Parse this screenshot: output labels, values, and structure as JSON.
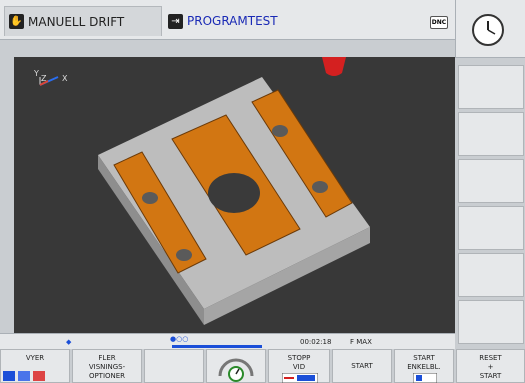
{
  "header": {
    "mode_manual_label": "MANUELL DRIFT",
    "mode_program_label": "PROGRAMTEST",
    "dnc_label": "DNC"
  },
  "viewport": {
    "axis_y": "Y",
    "axis_z": "Z",
    "axis_x": "X"
  },
  "status_bar": {
    "time": "00:02:18",
    "feed": "F MAX"
  },
  "softkeys": [
    {
      "label": "VYER"
    },
    {
      "label": "FLER\nVISNINGS-\nOPTIONER"
    },
    {
      "label": ""
    },
    {
      "label": ""
    },
    {
      "label": "STOPP\nVID"
    },
    {
      "label": "START"
    },
    {
      "label": "START\nENKELBL."
    },
    {
      "label": "RESET\n+\nSTART"
    }
  ],
  "colors": {
    "accent": "#1a2ab5",
    "workpiece": "#b9b9b9",
    "pocket": "#d87a12",
    "tool": "#d42020"
  }
}
